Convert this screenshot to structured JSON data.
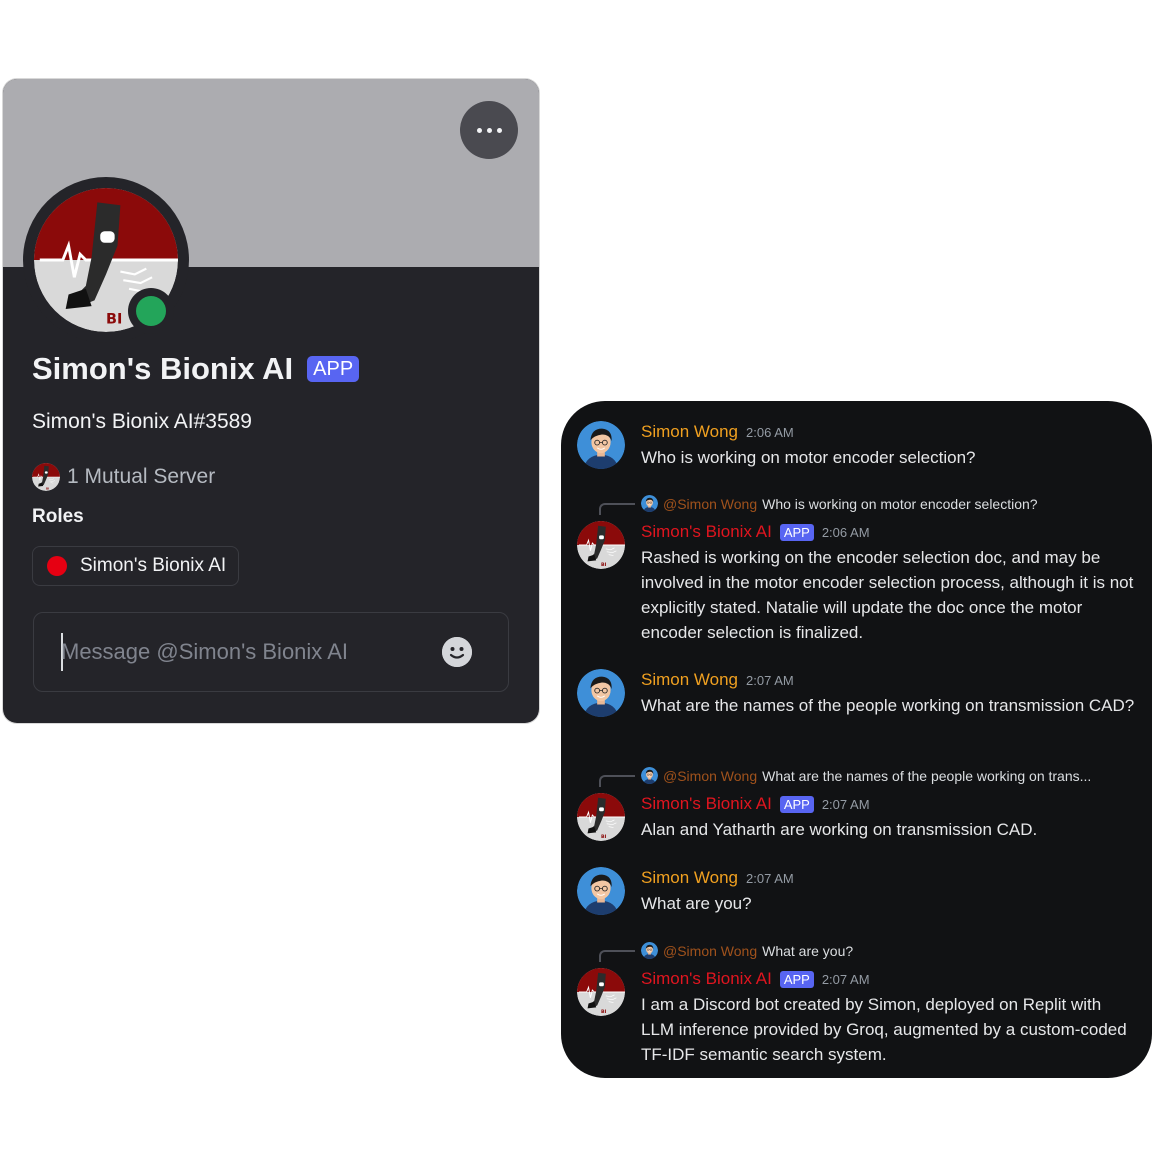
{
  "profile": {
    "bot_name": "Simon's Bionix AI",
    "app_badge": "APP",
    "bot_tag": "Simon's Bionix AI#3589",
    "mutual_servers": "1 Mutual Server",
    "roles_heading": "Roles",
    "role_name": "Simon's Bionix AI",
    "role_color": "#e60012",
    "status_color": "#23a55a",
    "message_placeholder": "Message @Simon's Bionix AI",
    "more_icon": "more-horizontal-icon",
    "emoji_icon": "emoji-smile-icon"
  },
  "chat": {
    "messages": [
      {
        "author": "Simon Wong",
        "time": "2:06 AM",
        "text": "Who is working on motor encoder selection?"
      },
      {
        "reply_mention": "@Simon Wong",
        "reply_text": "Who is working on motor encoder selection?",
        "author": "Simon's Bionix AI",
        "badge": "APP",
        "time": "2:06 AM",
        "text": "Rashed is working on the encoder selection doc, and may be involved in the motor encoder selection process, although it is not explicitly stated. Natalie will update the doc once the motor encoder selection is finalized."
      },
      {
        "author": "Simon Wong",
        "time": "2:07 AM",
        "text": "What are the names of the people working on transmission CAD?"
      },
      {
        "reply_mention": "@Simon Wong",
        "reply_text": "What are the names of the people working on trans...",
        "author": "Simon's Bionix AI",
        "badge": "APP",
        "time": "2:07 AM",
        "text": "Alan and Yatharth are working on transmission CAD."
      },
      {
        "author": "Simon Wong",
        "time": "2:07 AM",
        "text": "What are you?"
      },
      {
        "reply_mention": "@Simon Wong",
        "reply_text": "What are you?",
        "author": "Simon's Bionix AI",
        "badge": "APP",
        "time": "2:07 AM",
        "text": "I am a Discord bot created by Simon, deployed on Replit with LLM inference provided by Groq, augmented by a custom-coded TF-IDF semantic search system."
      }
    ]
  },
  "colors": {
    "user_name": "#f0a020",
    "bot_name": "#e0151f",
    "app_badge": "#5865f2"
  }
}
